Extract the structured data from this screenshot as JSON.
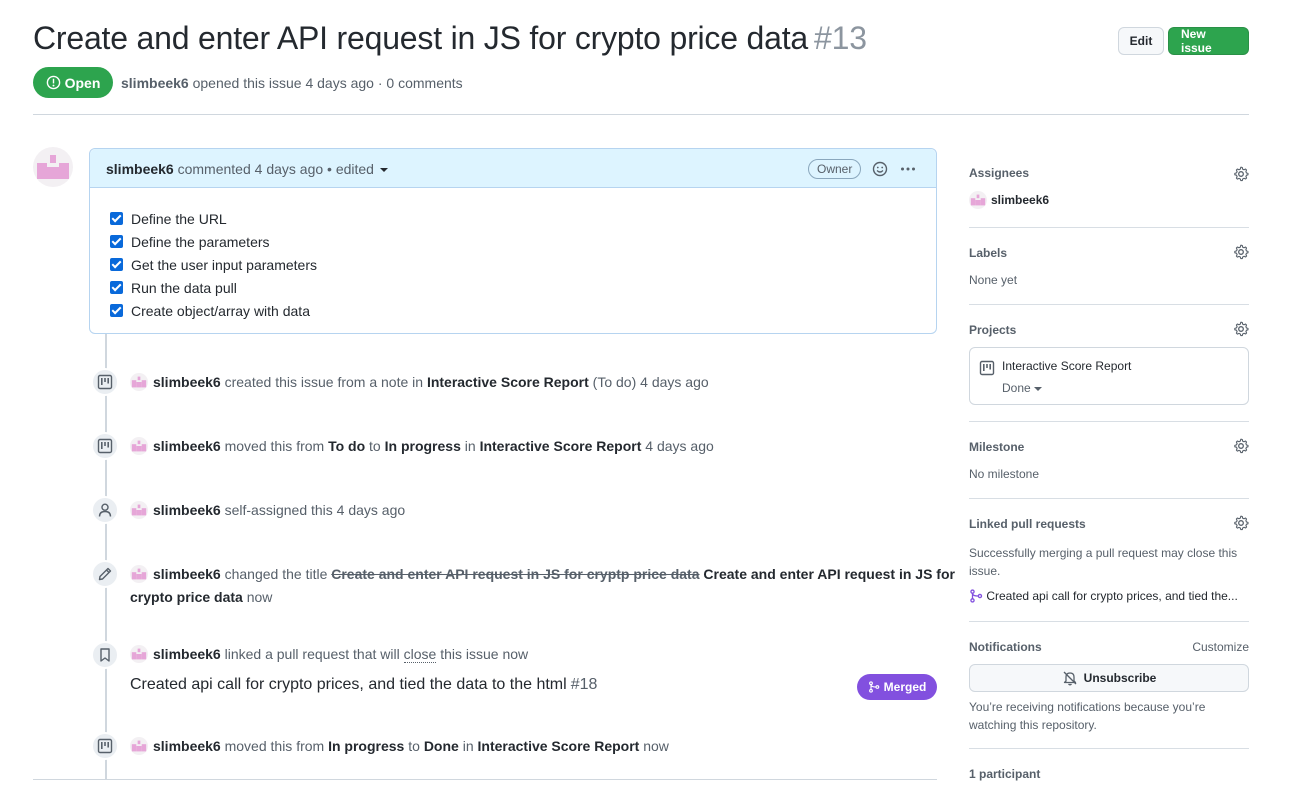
{
  "header": {
    "title": "Create and enter API request in JS for crypto price data",
    "number": "#13",
    "edit_label": "Edit",
    "new_issue_label": "New issue",
    "state_label": "Open",
    "author": "slimbeek6",
    "meta_text": "opened this issue 4 days ago · 0 comments"
  },
  "comment": {
    "author": "slimbeek6",
    "meta": "commented 4 days ago • edited",
    "owner_badge": "Owner",
    "tasks": [
      "Define the URL",
      "Define the parameters",
      "Get the user input parameters",
      "Run the data pull",
      "Create object/array with data"
    ]
  },
  "timeline": {
    "e1": {
      "user": "slimbeek6",
      "t1": "created this issue from a note in",
      "project": "Interactive Score Report",
      "column": "(To do)",
      "time": "4 days ago"
    },
    "e2": {
      "user": "slimbeek6",
      "t1": "moved this from",
      "from": "To do",
      "t2": "to",
      "to": "In progress",
      "t3": "in",
      "project": "Interactive Score Report",
      "time": "4 days ago"
    },
    "e3": {
      "user": "slimbeek6",
      "t1": "self-assigned this",
      "time": "4 days ago"
    },
    "e4": {
      "user": "slimbeek6",
      "t1": "changed the title",
      "old_title": "Create and enter API request in JS for cryptp price data",
      "new_title_a": "Create and enter API request in JS for",
      "new_title_b": "crypto price data",
      "time": "now"
    },
    "e5": {
      "user": "slimbeek6",
      "t1": "linked a pull request that will",
      "close": "close",
      "t2": "this issue",
      "time": "now",
      "pr_title": "Created api call for crypto prices, and tied the data to the html",
      "pr_number": "#18",
      "merged_label": "Merged"
    },
    "e6": {
      "user": "slimbeek6",
      "t1": "moved this from",
      "from": "In progress",
      "t2": "to",
      "to": "Done",
      "t3": "in",
      "project": "Interactive Score Report",
      "time": "now"
    }
  },
  "sidebar": {
    "assignees_label": "Assignees",
    "assignee": "slimbeek6",
    "labels_label": "Labels",
    "labels_value": "None yet",
    "projects_label": "Projects",
    "project_name": "Interactive Score Report",
    "project_state": "Done",
    "milestone_label": "Milestone",
    "milestone_value": "No milestone",
    "linked_label": "Linked pull requests",
    "linked_desc_1": "Successfully merging a pull request may close this",
    "linked_desc_2": "issue.",
    "linked_pr": "Created api call for crypto prices, and tied the...",
    "notifications_label": "Notifications",
    "customize_label": "Customize",
    "unsubscribe_label": "Unsubscribe",
    "notif_desc_1": "You’re receiving notifications because you’re",
    "notif_desc_2": "watching this repository.",
    "participants": "1 participant"
  },
  "colors": {
    "open_green": "#2da44e",
    "merged_purple": "#8250df",
    "comment_header_bg": "#ddf4ff",
    "checkbox_blue": "#0969da"
  },
  "icons": [
    "issue-opened-icon",
    "smiley-icon",
    "kebab-horizontal-icon",
    "project-icon",
    "person-icon",
    "pencil-icon",
    "bookmark-icon",
    "git-merge-icon",
    "gear-icon",
    "bell-slash-icon",
    "git-pull-request-icon"
  ]
}
